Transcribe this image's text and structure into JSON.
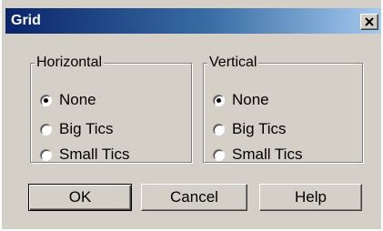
{
  "title": "Grid",
  "horizontal": {
    "label": "Horizontal",
    "options": [
      "None",
      "Big Tics",
      "Small Tics"
    ],
    "selected": "None"
  },
  "vertical": {
    "label": "Vertical",
    "options": [
      "None",
      "Big Tics",
      "Small Tics"
    ],
    "selected": "None"
  },
  "buttons": {
    "ok": "OK",
    "cancel": "Cancel",
    "help": "Help"
  },
  "icons": {
    "close": "close-icon",
    "radio_selected": "radio-selected-icon",
    "radio_unselected": "radio-unselected-icon"
  }
}
